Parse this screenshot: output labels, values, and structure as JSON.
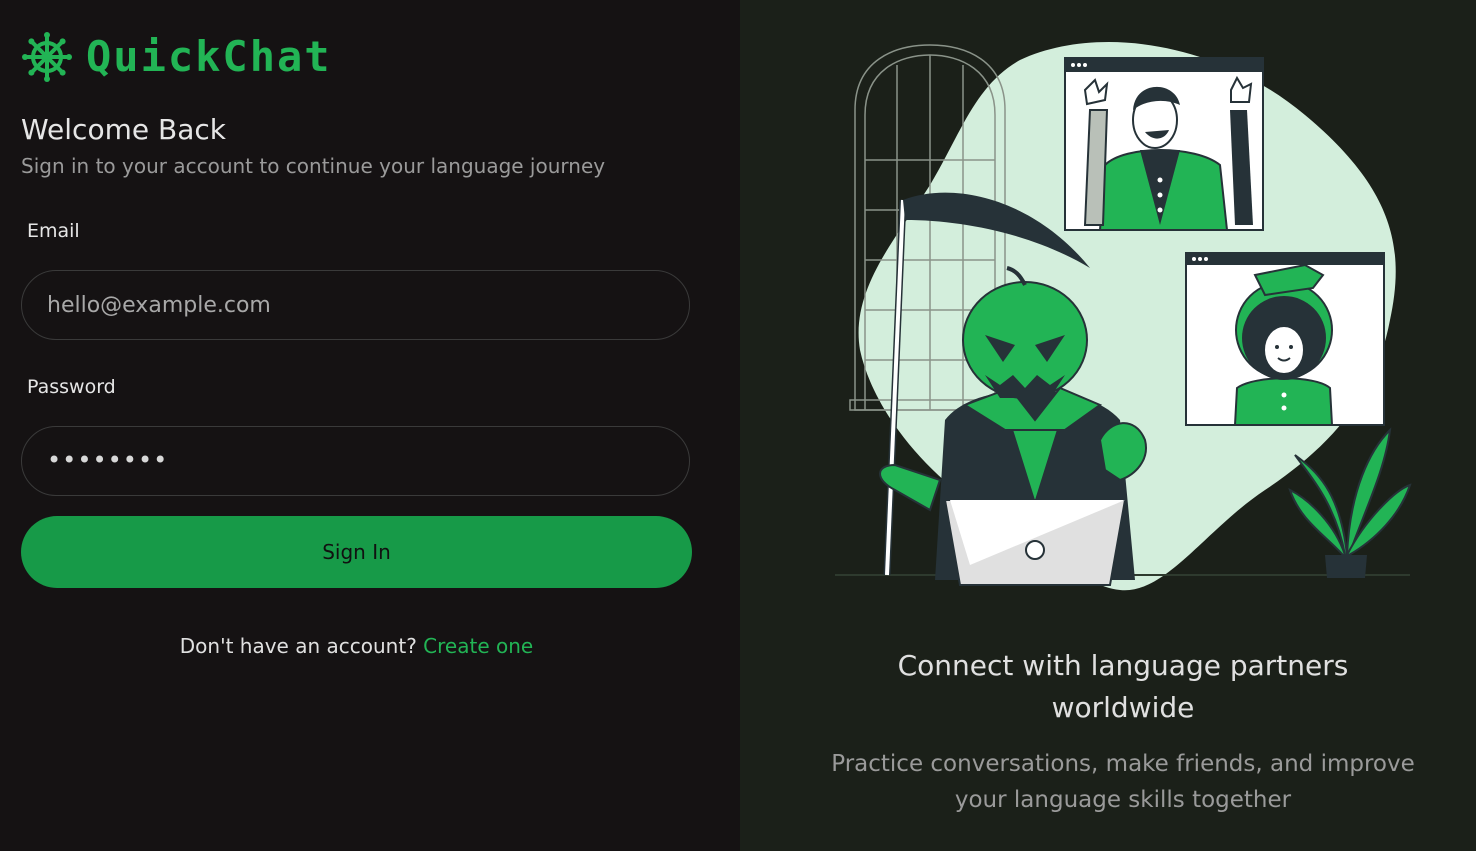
{
  "brand": {
    "name": "QuickChat",
    "icon": "dharma-wheel-icon",
    "color": "#22b455"
  },
  "login": {
    "title": "Welcome Back",
    "subtitle": "Sign in to your account to continue your language journey",
    "email_label": "Email",
    "email_placeholder": "hello@example.com",
    "password_label": "Password",
    "password_value": "••••••••",
    "submit_label": "Sign In",
    "no_account_text": "Don't have an account?",
    "create_link": "Create one"
  },
  "promo": {
    "title_line1": "Connect with language partners",
    "title_line2": "worldwide",
    "subtitle_line1": "Practice conversations, make friends, and improve",
    "subtitle_line2": "your language skills together",
    "illustration": "halloween-video-call-illustration"
  },
  "colors": {
    "accent": "#22b455",
    "button": "#179a48",
    "left_bg": "#151213",
    "right_bg": "#1b2019"
  }
}
